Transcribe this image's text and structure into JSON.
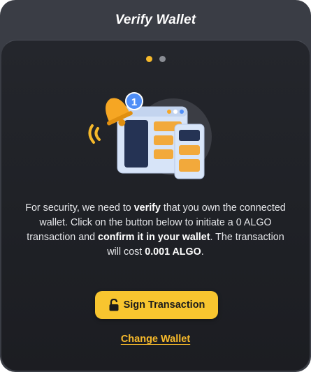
{
  "modal": {
    "title": "Verify Wallet"
  },
  "pager": {
    "current": 1,
    "total": 2
  },
  "illustration": {
    "icon": "wallet-notification-icon",
    "badge_count": "1"
  },
  "message": {
    "p1": "For security, we need to ",
    "p1_bold": "verify",
    "p2": " that you own the connected wallet. Click on the button below to initiate a 0 ALGO transaction and ",
    "p2_bold": "confirm it in your wallet",
    "p3": ". The transaction will cost ",
    "p3_bold": "0.001 ALGO",
    "p4": "."
  },
  "actions": {
    "sign_label": "Sign Transaction",
    "sign_icon": "lock-icon",
    "change_label": "Change Wallet"
  },
  "colors": {
    "accent": "#f8c52f",
    "header_bg": "#3a3d45",
    "body_bg": "#1f2126"
  }
}
